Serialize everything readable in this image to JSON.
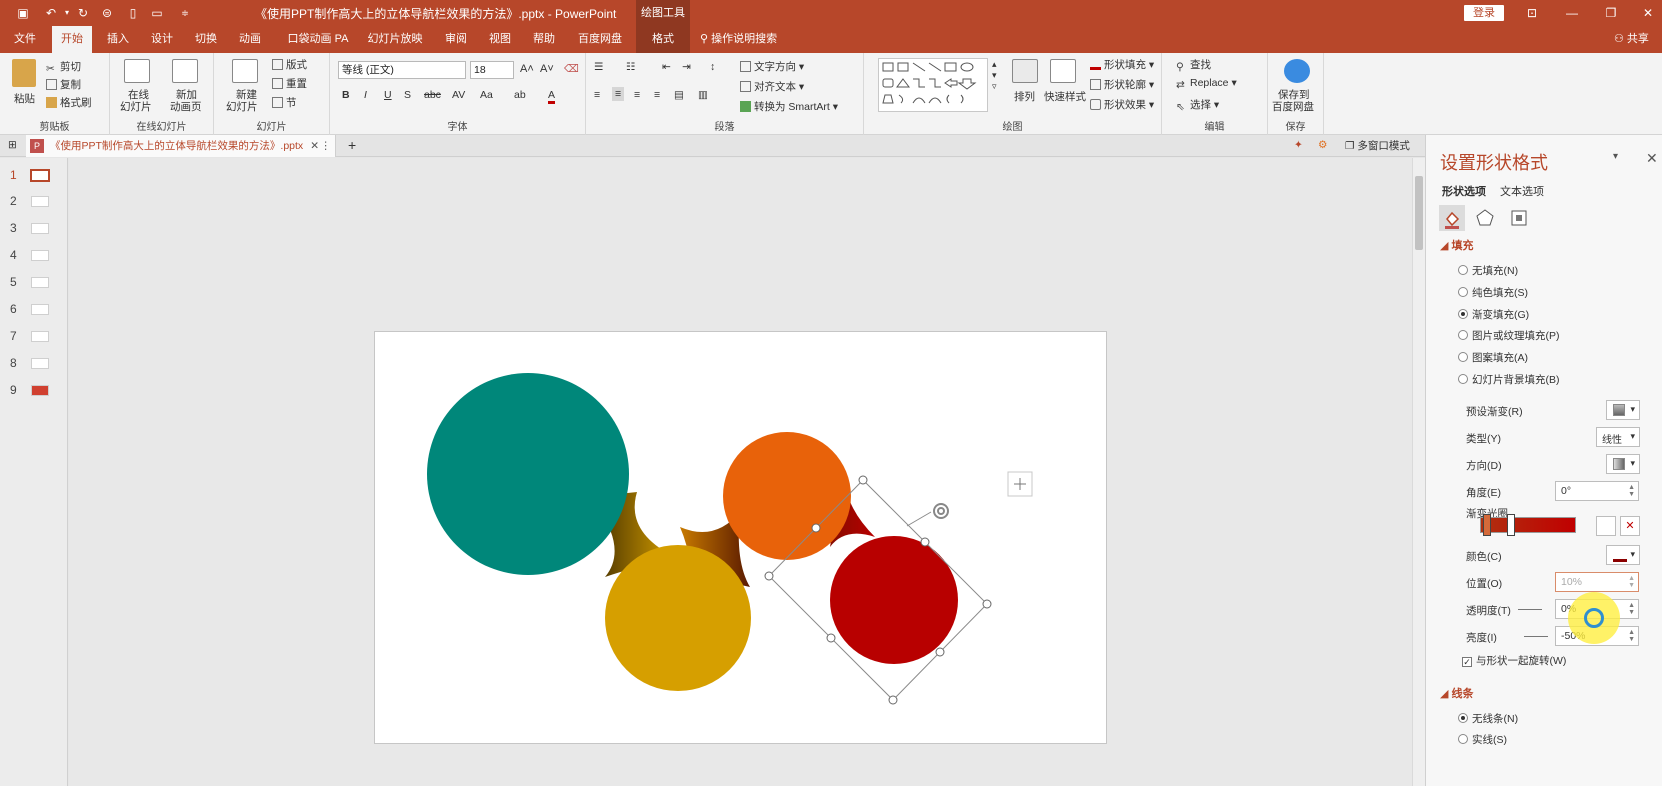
{
  "titlebar": {
    "title": "《使用PPT制作高大上的立体导航栏效果的方法》.pptx  -  PowerPoint",
    "tools_tab": "绘图工具",
    "login": "登录"
  },
  "menu": {
    "tabs": [
      "文件",
      "开始",
      "插入",
      "设计",
      "切换",
      "动画",
      "口袋动画 PA",
      "幻灯片放映",
      "审阅",
      "视图",
      "帮助",
      "百度网盘",
      "格式"
    ],
    "search": "操作说明搜索",
    "share": "共享"
  },
  "ribbon": {
    "clipboard": {
      "label": "剪贴板",
      "paste": "粘贴",
      "cut": "剪切",
      "copy": "复制",
      "format_painter": "格式刷"
    },
    "online": {
      "label": "在线幻灯片",
      "online_slides_1": "在线",
      "online_slides_2": "幻灯片",
      "new_anim_1": "新加",
      "new_anim_2": "动画页"
    },
    "slides": {
      "label": "幻灯片",
      "new_slide_1": "新建",
      "new_slide_2": "幻灯片",
      "layout": "版式",
      "reset": "重置",
      "section": "节"
    },
    "font": {
      "label": "字体",
      "font_name": "等线 (正文)",
      "font_size": "18",
      "bold": "B",
      "italic": "I",
      "underline": "U",
      "shadow": "S",
      "strike": "abc"
    },
    "paragraph": {
      "label": "段落",
      "text_direction": "文字方向",
      "align_text": "对齐文本",
      "smartart": "转换为 SmartArt"
    },
    "drawing": {
      "label": "绘图",
      "arrange": "排列",
      "quick_styles": "快速样式",
      "shape_fill": "形状填充",
      "shape_outline": "形状轮廓",
      "shape_effects": "形状效果"
    },
    "editing": {
      "label": "编辑",
      "find": "查找",
      "replace": "Replace",
      "select": "选择"
    },
    "save": {
      "label": "保存",
      "save_to_1": "保存到",
      "save_to_2": "百度网盘"
    }
  },
  "doc_tab": {
    "name": "《使用PPT制作高大上的立体导航栏效果的方法》.pptx",
    "multi_window": "多窗口模式"
  },
  "thumbnails": [
    "1",
    "2",
    "3",
    "4",
    "5",
    "6",
    "7",
    "8",
    "9"
  ],
  "colors": {
    "teal": "#00877a",
    "gold": "#d69f00",
    "orange": "#e8620a",
    "red": "#b80000",
    "accent": "#b7472a"
  },
  "pane": {
    "title": "设置形状格式",
    "tab_shape": "形状选项",
    "tab_text": "文本选项",
    "fill_header": "填充",
    "fill_options": [
      {
        "label": "无填充(N)",
        "selected": false
      },
      {
        "label": "纯色填充(S)",
        "selected": false
      },
      {
        "label": "渐变填充(G)",
        "selected": true
      },
      {
        "label": "图片或纹理填充(P)",
        "selected": false
      },
      {
        "label": "图案填充(A)",
        "selected": false
      },
      {
        "label": "幻灯片背景填充(B)",
        "selected": false
      }
    ],
    "preset_label": "预设渐变(R)",
    "type_label": "类型(Y)",
    "type_value": "线性",
    "direction_label": "方向(D)",
    "angle_label": "角度(E)",
    "angle_value": "0°",
    "stops_label": "渐变光圈",
    "color_label": "颜色(C)",
    "position_label": "位置(O)",
    "position_value": "10%",
    "transparency_label": "透明度(T)",
    "transparency_value": "0%",
    "brightness_label": "亮度(I)",
    "brightness_value": "-50%",
    "rotate_label": "与形状一起旋转(W)",
    "line_header": "线条",
    "line_options": [
      {
        "label": "无线条(N)",
        "selected": true
      },
      {
        "label": "实线(S)",
        "selected": false
      }
    ]
  }
}
